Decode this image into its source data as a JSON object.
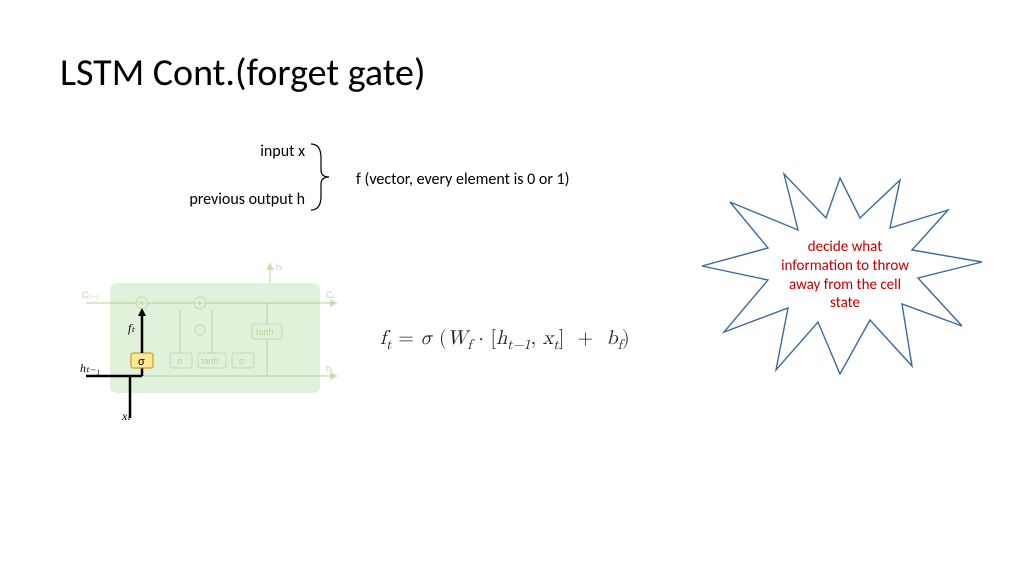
{
  "title": "LSTM Cont.(forget gate)",
  "brace": {
    "line1": "input x",
    "line2": "previous output h"
  },
  "f_desc": "f (vector, every element is 0 or 1)",
  "equation": {
    "full": "fₜ = σ (W_f · [hₜ₋₁, xₜ]  +  b_f)"
  },
  "star_text": "decide what information to throw away from the cell state",
  "lstm_labels": {
    "ft": "fₜ",
    "sigma": "σ",
    "ht1": "hₜ₋₁",
    "xt": "xₜ",
    "ht_top": "hₜ",
    "ht_right": "hₜ",
    "c_left": "Cₜ₋₁",
    "c_right": "Cₜ",
    "tanh": "tanh"
  }
}
